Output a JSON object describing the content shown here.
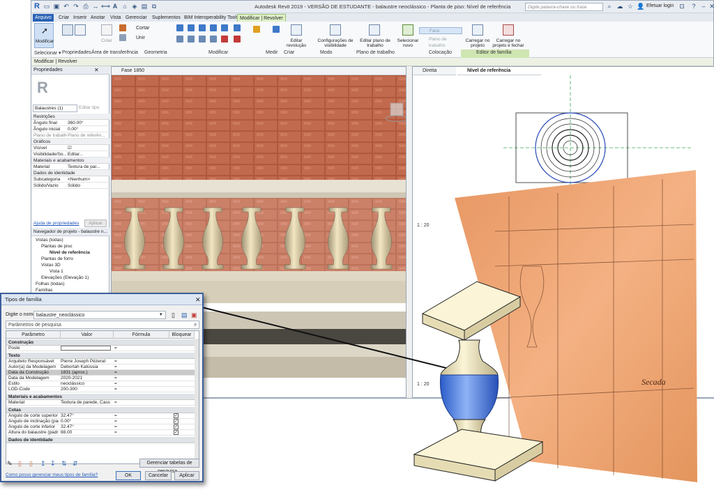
{
  "app": {
    "title": "Autodesk Revit 2019 - VERSÃO DE ESTUDANTE - balaustre neoclássico - Planta de piso: Nível de referência",
    "search_placeholder": "Digite palavra-chave ou frase",
    "login": "Efetuar login"
  },
  "tabs": [
    "Arquivo",
    "Criar",
    "Inserir",
    "Anotar",
    "Vista",
    "Gerenciar",
    "Suplementos",
    "BIM Interoperability Tools",
    "Modificar | Revolver"
  ],
  "ribbon": {
    "modify_label": "Modificar",
    "cut_label": "Cortar",
    "join_label": "Unir",
    "paste_label": "Colar",
    "panels": [
      "Selecionar ▾",
      "Propriedades",
      "Área de transferência",
      "Geometria",
      "Modificar",
      "Medir",
      "Criar",
      "Modo",
      "Plano de trabalho",
      "Colocação",
      "Editor de família"
    ],
    "buttons": [
      "Editar revolução",
      "Configurações de visibilidade",
      "Editar plano de trabalho",
      "Selecionar novo",
      "Carregar no projeto",
      "Carregar no projeto e fechar"
    ],
    "face_label": "Face",
    "workplane_face_label": "Plano de trabalho"
  },
  "options_bar": "Modificar | Revolver",
  "properties": {
    "header": "Propriedades",
    "type_selector": "Balaustres (1)",
    "edit_type": "Editar tipo",
    "groups": {
      "restrictions": "Restrições",
      "graphics": "Gráficos",
      "materials": "Materiais e acabamentos",
      "identity": "Dados de identidade"
    },
    "rows": [
      {
        "k": "Ângulo final",
        "v": "360.00°"
      },
      {
        "k": "Ângulo inicial",
        "v": "0.00°"
      },
      {
        "k": "Plano de trabalho",
        "v": "Plano de referên..."
      },
      {
        "k": "Visível",
        "v": "☑"
      },
      {
        "k": "Visibilidade/So...",
        "v": "Editar..."
      },
      {
        "k": "Material",
        "v": "Textura de par..."
      },
      {
        "k": "Subcategoria",
        "v": "<Nenhum>"
      },
      {
        "k": "Sólido/Vazio",
        "v": "Sólido"
      }
    ],
    "help_link": "Ajuda de propriedades",
    "apply": "Aplicar"
  },
  "browser": {
    "header": "Navegador de projeto - balaustre n...",
    "items": [
      "Vistas (todas)",
      "Plantas de piso",
      "Nível de referência",
      "Plantas de forro",
      "Vistas 3D",
      "Vista 1",
      "Elevações (Elevação 1)",
      "Folhas (todas)",
      "Famílias"
    ]
  },
  "views": {
    "view3d_tab": "Fase 1850",
    "plan_tab_1": "Direita",
    "plan_tab_2": "Nível de referência",
    "scale": "1 : 20",
    "drawing_text": "Secada"
  },
  "dialog": {
    "title": "Tipos de família",
    "type_name_label": "Digite o nome:",
    "type_name_value": "balaustre_neoclássico",
    "search_placeholder": "Parâmetros de pesquisa",
    "columns": [
      "Parâmetro",
      "Valor",
      "Fórmula",
      "Bloquear"
    ],
    "groups": [
      {
        "name": "Construção",
        "rows": [
          {
            "p": "Poste",
            "v": "",
            "f": "=",
            "lock": false
          }
        ]
      },
      {
        "name": "Texto",
        "rows": [
          {
            "p": "Arquiteto Responsável",
            "v": "Pierre Joseph Pézerat",
            "f": "=",
            "lock": false
          },
          {
            "p": "Autor(a) da Modelagem",
            "v": "Debortah Katússia",
            "f": "=",
            "lock": false
          },
          {
            "p": "Data da Construção",
            "v": "1831 (aprox.)",
            "f": "=",
            "lock": false
          },
          {
            "p": "Data da Modelagem",
            "v": "2020-2021",
            "f": "=",
            "lock": false
          },
          {
            "p": "Estilo",
            "v": "neoclássico",
            "f": "=",
            "lock": false
          },
          {
            "p": "LOD-Code",
            "v": "200-300",
            "f": "=",
            "lock": false
          }
        ]
      },
      {
        "name": "Materiais e acabamentos",
        "rows": [
          {
            "p": "Material",
            "v": "Textura de parede, Cass",
            "f": "=",
            "lock": false
          }
        ]
      },
      {
        "name": "Cotas",
        "rows": [
          {
            "p": "Ângulo de corte superior (",
            "v": "32.47°",
            "f": "=",
            "lock": true
          },
          {
            "p": "Ângulo de inclinação (padr",
            "v": "0.00°",
            "f": "=",
            "lock": true
          },
          {
            "p": "Ângulo de corte inferior",
            "v": "32.47°",
            "f": "=",
            "lock": true
          },
          {
            "p": "Altura do balaustre (padrã",
            "v": "88.00",
            "f": "=",
            "lock": true
          }
        ]
      },
      {
        "name": "Dados de identidade",
        "rows": []
      }
    ],
    "manage_tables_button": "Gerenciar tabelas de pesquisa...",
    "help_link": "Como posso gerenciar meus tipos de família?",
    "ok": "OK",
    "cancel": "Cancelar",
    "apply": "Aplicar"
  }
}
